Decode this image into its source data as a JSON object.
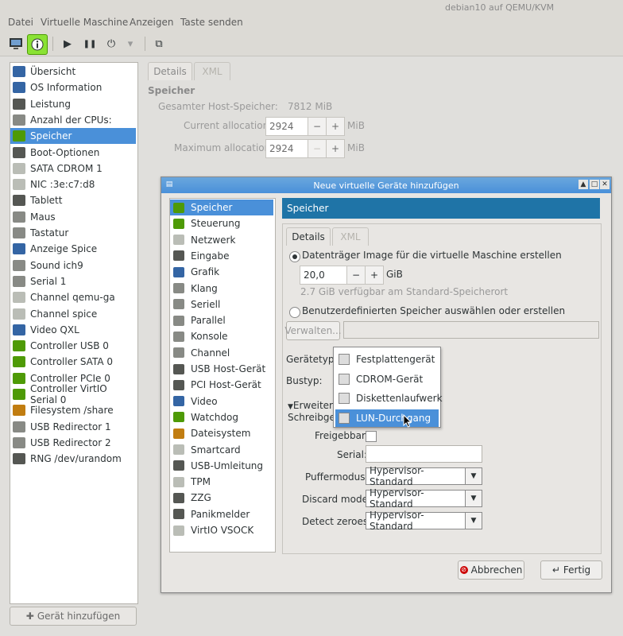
{
  "window": {
    "title": "debian10 auf QEMU/KVM"
  },
  "menu": [
    "Datei",
    "Virtuelle Maschine",
    "Anzeigen",
    "Taste senden"
  ],
  "toolbar": {
    "monitor": "monitor-icon",
    "info": "info-icon",
    "play": "▶",
    "pause": "❚❚",
    "power": "⏻",
    "dropdown": "▾",
    "screens": "⧉"
  },
  "sidebar": {
    "selected_index": 4,
    "items": [
      {
        "label": "Übersicht",
        "icon": "monitor-icon",
        "color": "#3465a4"
      },
      {
        "label": "OS Information",
        "icon": "monitor-icon",
        "color": "#3465a4"
      },
      {
        "label": "Leistung",
        "icon": "chart-icon",
        "color": "#555753"
      },
      {
        "label": "Anzahl der CPUs:",
        "icon": "cpu-icon",
        "color": "#888a85"
      },
      {
        "label": "Speicher",
        "icon": "memory-icon",
        "color": "#4e9a06"
      },
      {
        "label": "Boot-Optionen",
        "icon": "gear-icon",
        "color": "#555753"
      },
      {
        "label": "SATA CDROM 1",
        "icon": "cdrom-icon",
        "color": "#babdb6"
      },
      {
        "label": "NIC :3e:c7:d8",
        "icon": "network-icon",
        "color": "#babdb6"
      },
      {
        "label": "Tablett",
        "icon": "tablet-icon",
        "color": "#555753"
      },
      {
        "label": "Maus",
        "icon": "mouse-icon",
        "color": "#888a85"
      },
      {
        "label": "Tastatur",
        "icon": "keyboard-icon",
        "color": "#888a85"
      },
      {
        "label": "Anzeige Spice",
        "icon": "monitor-icon",
        "color": "#3465a4"
      },
      {
        "label": "Sound ich9",
        "icon": "sound-icon",
        "color": "#888a85"
      },
      {
        "label": "Serial 1",
        "icon": "serial-icon",
        "color": "#888a85"
      },
      {
        "label": "Channel qemu-ga",
        "icon": "channel-icon",
        "color": "#babdb6"
      },
      {
        "label": "Channel spice",
        "icon": "channel-icon",
        "color": "#babdb6"
      },
      {
        "label": "Video QXL",
        "icon": "monitor-icon",
        "color": "#3465a4"
      },
      {
        "label": "Controller USB 0",
        "icon": "controller-icon",
        "color": "#4e9a06"
      },
      {
        "label": "Controller SATA 0",
        "icon": "controller-icon",
        "color": "#4e9a06"
      },
      {
        "label": "Controller PCIe 0",
        "icon": "controller-icon",
        "color": "#4e9a06"
      },
      {
        "label": "Controller VirtIO Serial 0",
        "icon": "controller-icon",
        "color": "#4e9a06"
      },
      {
        "label": "Filesystem /share",
        "icon": "folder-icon",
        "color": "#c17d11"
      },
      {
        "label": "USB Redirector 1",
        "icon": "usb-icon",
        "color": "#888a85"
      },
      {
        "label": "USB Redirector 2",
        "icon": "usb-icon",
        "color": "#888a85"
      },
      {
        "label": "RNG /dev/urandom",
        "icon": "gear-icon",
        "color": "#555753"
      }
    ],
    "add_button": "Gerät hinzufügen"
  },
  "main": {
    "tabs": [
      "Details",
      "XML"
    ],
    "section": "Speicher",
    "host_mem_label": "Gesamter Host-Speicher:",
    "host_mem_value": "7812 MiB",
    "current_label": "Current allocation:",
    "current_value": "2924",
    "max_label": "Maximum allocation:",
    "max_value": "2924",
    "unit": "MiB"
  },
  "dialog": {
    "title": "Neue virtuelle Geräte hinzufügen",
    "selected_index": 0,
    "items": [
      {
        "label": "Speicher",
        "icon": "memory-icon",
        "color": "#4e9a06"
      },
      {
        "label": "Steuerung",
        "icon": "controller-icon",
        "color": "#4e9a06"
      },
      {
        "label": "Netzwerk",
        "icon": "network-icon",
        "color": "#babdb6"
      },
      {
        "label": "Eingabe",
        "icon": "mouse-icon",
        "color": "#555753"
      },
      {
        "label": "Grafik",
        "icon": "monitor-icon",
        "color": "#3465a4"
      },
      {
        "label": "Klang",
        "icon": "sound-icon",
        "color": "#888a85"
      },
      {
        "label": "Seriell",
        "icon": "serial-icon",
        "color": "#888a85"
      },
      {
        "label": "Parallel",
        "icon": "serial-icon",
        "color": "#888a85"
      },
      {
        "label": "Konsole",
        "icon": "serial-icon",
        "color": "#888a85"
      },
      {
        "label": "Channel",
        "icon": "channel-icon",
        "color": "#888a85"
      },
      {
        "label": "USB Host-Gerät",
        "icon": "gear-icon",
        "color": "#555753"
      },
      {
        "label": "PCI Host-Gerät",
        "icon": "gear-icon",
        "color": "#555753"
      },
      {
        "label": "Video",
        "icon": "monitor-icon",
        "color": "#3465a4"
      },
      {
        "label": "Watchdog",
        "icon": "watchdog-icon",
        "color": "#4e9a06"
      },
      {
        "label": "Dateisystem",
        "icon": "folder-icon",
        "color": "#c17d11"
      },
      {
        "label": "Smartcard",
        "icon": "smartcard-icon",
        "color": "#babdb6"
      },
      {
        "label": "USB-Umleitung",
        "icon": "usb-icon",
        "color": "#555753"
      },
      {
        "label": "TPM",
        "icon": "tpm-icon",
        "color": "#babdb6"
      },
      {
        "label": "ZZG",
        "icon": "gear-icon",
        "color": "#555753"
      },
      {
        "label": "Panikmelder",
        "icon": "gear-icon",
        "color": "#555753"
      },
      {
        "label": "VirtIO VSOCK",
        "icon": "network-icon",
        "color": "#babdb6"
      }
    ],
    "header": "Speicher",
    "tabs": [
      "Details",
      "XML"
    ],
    "radio1": "Datenträger Image für die virtuelle Maschine erstellen",
    "size_value": "20,0",
    "size_unit": "GiB",
    "size_hint": "2.7 GiB verfügbar am Standard-Speicherort",
    "radio2": "Benutzerdefinierten Speicher auswählen oder erstellen",
    "manage_button": "Verwalten...",
    "device_type_label": "Gerätetyp:",
    "bus_type_label": "Bustyp:",
    "advanced_label": "Erweitert",
    "cache_label": "Schreibges",
    "shareable_label": "Freigebbar:",
    "serial_label": "Serial:",
    "cache_mode_label": "Puffermodus:",
    "cache_mode_value": "Hypervisor-Standard",
    "discard_label": "Discard mode:",
    "discard_value": "Hypervisor-Standard",
    "detect_label": "Detect zeroes:",
    "detect_value": "Hypervisor-Standard",
    "cancel_button": "Abbrechen",
    "finish_button": "Fertig"
  },
  "popup": {
    "selected_index": 3,
    "options": [
      "Festplattengerät",
      "CDROM-Gerät",
      "Diskettenlaufwerk",
      "LUN-Durchgang"
    ]
  }
}
